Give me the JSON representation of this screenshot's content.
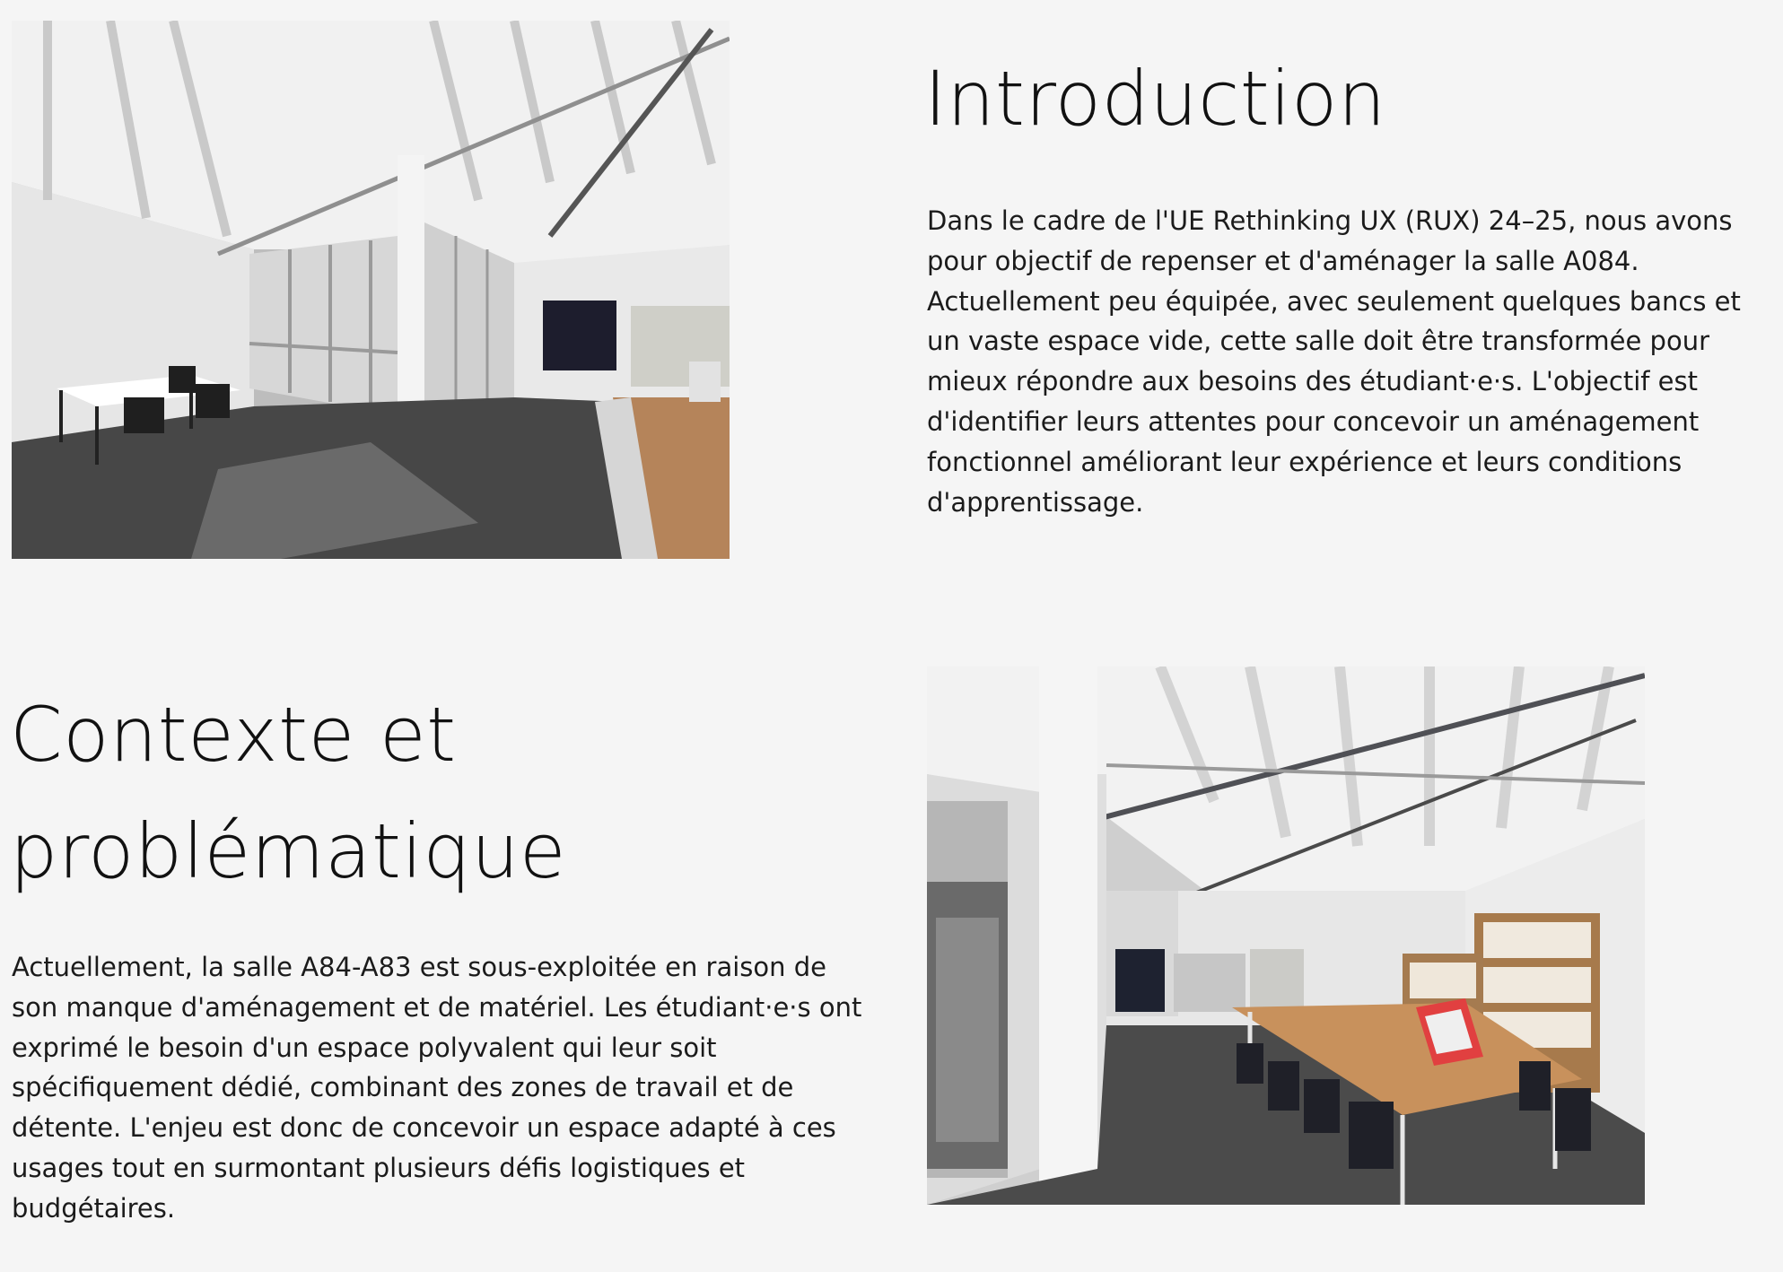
{
  "introduction": {
    "title": "Introduction",
    "paragraph": "Dans le cadre de l'UE Rethinking UX (RUX) 24–25, nous avons pour objectif de repenser et d'aménager la salle A084. Actuellement peu équipée, avec seulement quelques bancs et un vaste espace vide, cette salle doit être transformée pour mieux répondre aux besoins des étudiant·e·s. L'objectif est d'identifier leurs attentes pour concevoir un aménagement fonctionnel améliorant leur expérience et leurs conditions d'apprentissage."
  },
  "context": {
    "title": "Contexte et problématique",
    "paragraph": "Actuellement, la salle A84-A83 est sous-exploitée en raison de son manque d'aménagement et de matériel. Les étudiant·e·s ont exprimé le besoin d'un espace polyvalent qui leur soit spécifiquement dédié, combinant des zones de travail et de détente. L'enjeu est donc de concevoir un espace adapté à ces usages tout en surmontant plusieurs défis logistiques et budgétaires."
  },
  "colors": {
    "background": "#f5f5f5",
    "text": "#141414"
  }
}
